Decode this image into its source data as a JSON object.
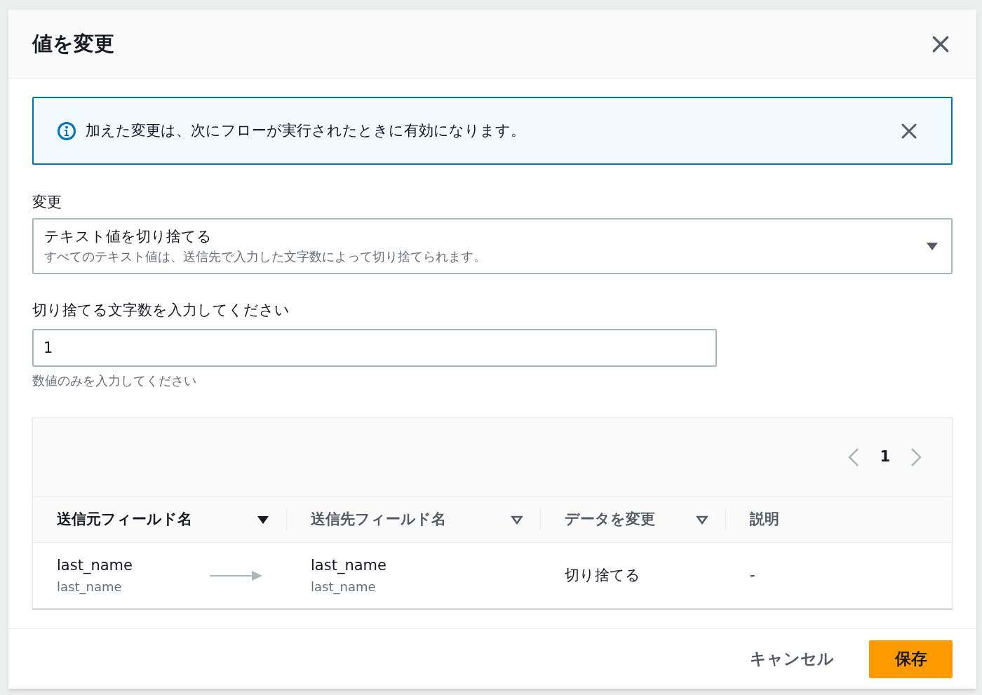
{
  "dialog": {
    "title": "値を変更"
  },
  "alert": {
    "message": "加えた変更は、次にフローが実行されたときに有効になります。"
  },
  "change": {
    "label": "変更",
    "selected_title": "テキスト値を切り捨てる",
    "selected_description": "すべてのテキスト値は、送信先で入力した文字数によって切り捨てられます。"
  },
  "length_field": {
    "label": "切り捨てる文字数を入力してください",
    "value": "1",
    "hint": "数値のみを入力してください"
  },
  "table": {
    "pagination": {
      "page": "1"
    },
    "columns": [
      {
        "label": "送信元フィールド名",
        "kind": "sortable",
        "sorted": true
      },
      {
        "label": "送信先フィールド名",
        "kind": "sortable",
        "sorted": false
      },
      {
        "label": "データを変更",
        "kind": "sortable",
        "sorted": false
      },
      {
        "label": "説明",
        "kind": "plain"
      }
    ],
    "rows": [
      {
        "source": "last_name",
        "source_sub": "last_name",
        "destination": "last_name",
        "destination_sub": "last_name",
        "change": "切り捨てる",
        "description": "-"
      }
    ]
  },
  "buttons": {
    "cancel": "キャンセル",
    "save": "保存"
  }
}
